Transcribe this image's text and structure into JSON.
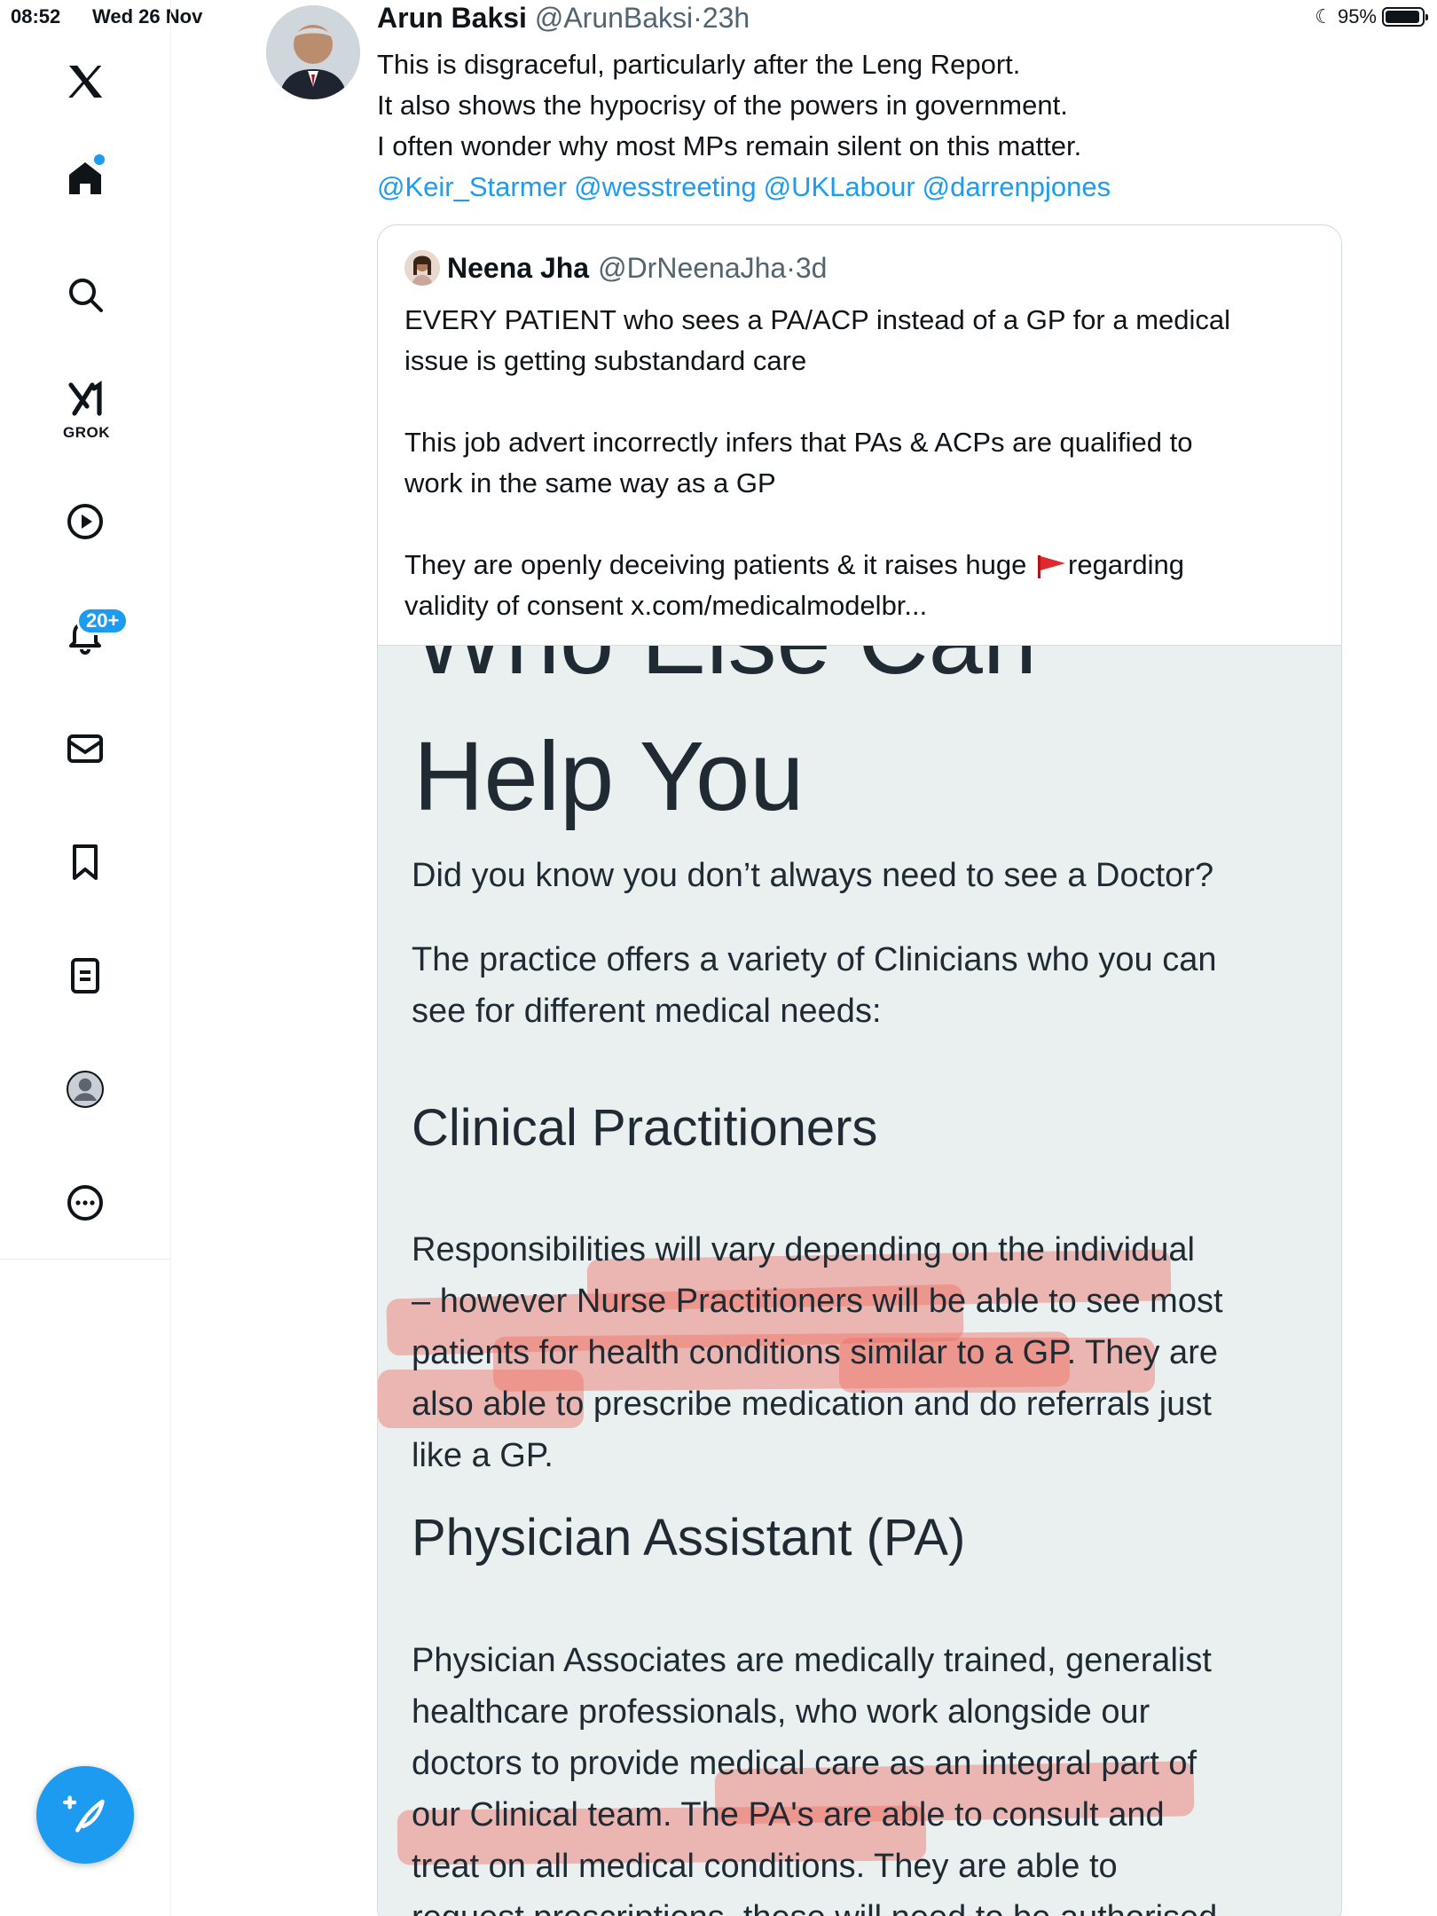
{
  "status_bar": {
    "time": "08:52",
    "date": "Wed 26 Nov",
    "battery": "95%",
    "battery_level": 0.95
  },
  "sidebar": {
    "logo": "x-logo-icon",
    "items": [
      {
        "icon": "home-icon",
        "has_dot": true
      },
      {
        "icon": "search-icon"
      },
      {
        "icon": "grok-icon",
        "label": "GROK"
      },
      {
        "icon": "play-icon"
      },
      {
        "icon": "bell-icon",
        "badge": "20+"
      },
      {
        "icon": "mail-icon"
      },
      {
        "icon": "bookmark-icon"
      },
      {
        "icon": "list-icon"
      },
      {
        "icon": "profile-icon"
      },
      {
        "icon": "more-icon"
      }
    ],
    "compose": "compose-icon"
  },
  "tweet": {
    "name": "Arun Baksi",
    "handle": "@ArunBaksi",
    "time": "23h",
    "lines": [
      "This is disgraceful, particularly after the Leng Report.",
      "It also shows the hypocrisy of the powers in government.",
      "I often wonder why most MPs remain silent on this matter."
    ],
    "mentions": [
      "@Keir_Starmer",
      "@wesstreeting",
      "@UKLabour",
      "@darrenpjones"
    ]
  },
  "quote": {
    "name": "Neena Jha",
    "handle": "@DrNeenaJha",
    "time": "3d",
    "para1": [
      "EVERY PATIENT who sees a PA/ACP instead of a GP for a medical",
      "issue is getting substandard care"
    ],
    "para2": [
      "This job advert incorrectly infers that PAs & ACPs are qualified to",
      "work in the same way as a GP"
    ],
    "para3_line1_a": "They are openly deceiving patients & it raises huge",
    "para3_line1_b": "regarding",
    "para3_line2": "validity of consent x.com/medicalmodelbr..."
  },
  "embed": {
    "cut_title": "Who Else Can",
    "title": "Help You",
    "intro": "Did you know you don’t always need to see a Doctor?",
    "offer": [
      "The practice offers a variety of Clinicians who you can",
      "see for different medical needs:"
    ],
    "heading1": "Clinical Practitioners",
    "cp": [
      "Responsibilities will vary depending on the individual",
      "– however Nurse Practitioners will be able to see most",
      "patients for health conditions similar to a GP. They are",
      "also able to prescribe medication and do referrals just",
      "like a GP."
    ],
    "heading2": "Physician Assistant (PA)",
    "pa": [
      "Physician Associates are medically trained, generalist",
      "healthcare professionals, who work alongside our",
      "doctors to provide medical care as an integral part of",
      "our Clinical team. The PA's are able to consult and",
      "treat on all medical conditions. They are able to",
      "request prescriptions, these will need to be authorised"
    ]
  },
  "colors": {
    "accent": "#1d9bf0",
    "highlight": "#ed6e64"
  }
}
